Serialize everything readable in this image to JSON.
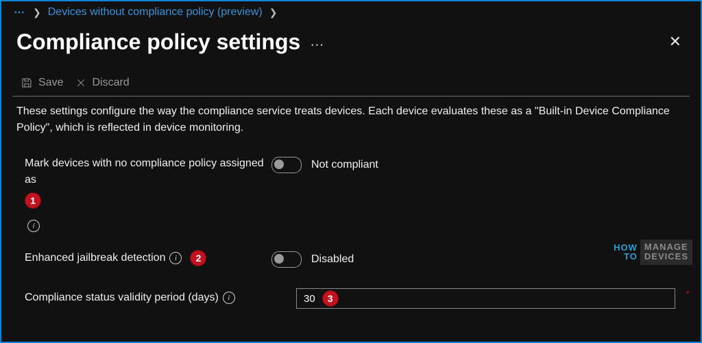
{
  "breadcrumb": {
    "ellipsis": "⋯",
    "item": "Devices without compliance policy (preview)"
  },
  "header": {
    "title": "Compliance policy settings",
    "more": "⋯"
  },
  "toolbar": {
    "save_label": "Save",
    "discard_label": "Discard"
  },
  "description": "These settings configure the way the compliance service treats devices. Each device evaluates these as a \"Built-in Device Compliance Policy\", which is reflected in device monitoring.",
  "settings": {
    "mark_devices": {
      "label": "Mark devices with no compliance policy assigned as",
      "callout": "1",
      "value_label": "Not compliant"
    },
    "jailbreak": {
      "label": "Enhanced jailbreak detection",
      "callout": "2",
      "value_label": "Disabled"
    },
    "validity": {
      "label": "Compliance status validity period (days)",
      "callout": "3",
      "value": "30"
    }
  },
  "watermark": {
    "top_left": "HOW",
    "bottom_left": "TO",
    "top_right": "MANAGE",
    "bottom_right": "DEVICES"
  }
}
